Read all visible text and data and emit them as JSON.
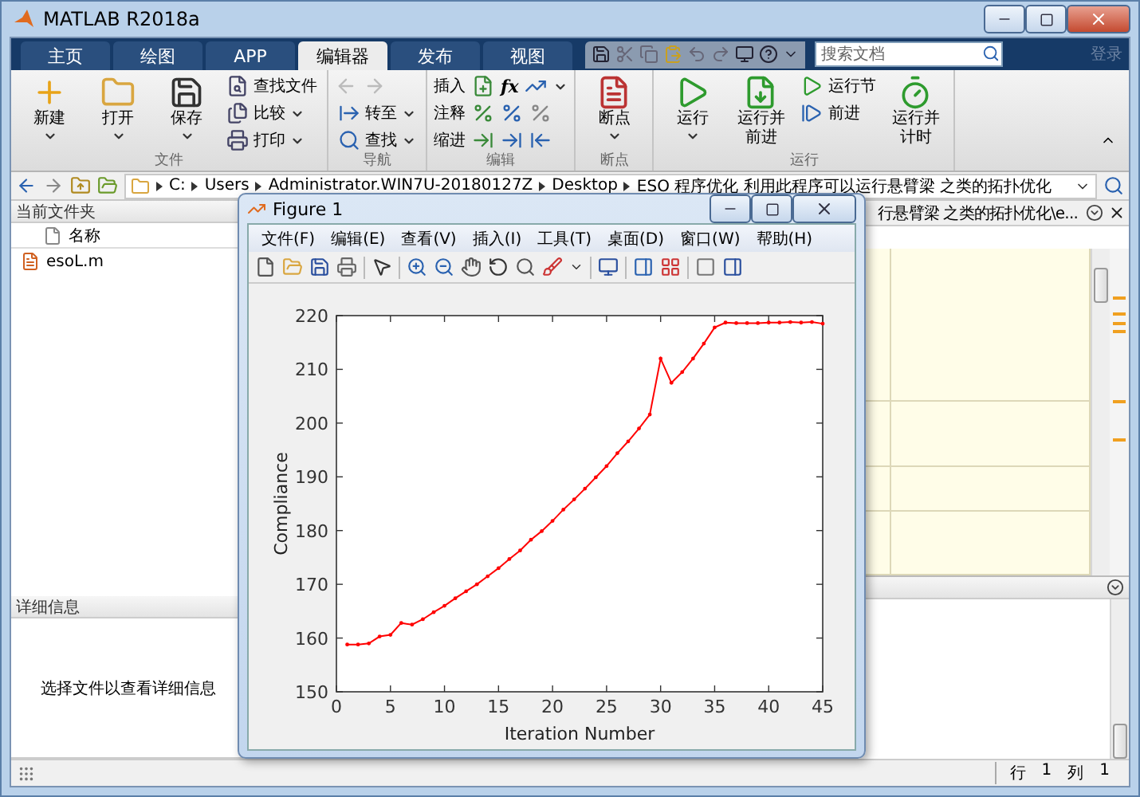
{
  "window": {
    "title": "MATLAB R2018a"
  },
  "tabs": [
    {
      "label": "主页",
      "selected": false
    },
    {
      "label": "绘图",
      "selected": false
    },
    {
      "label": "APP",
      "selected": false
    },
    {
      "label": "编辑器",
      "selected": true
    },
    {
      "label": "发布",
      "selected": false
    },
    {
      "label": "视图",
      "selected": false
    }
  ],
  "search": {
    "placeholder": "搜索文档"
  },
  "login": {
    "label": "登录",
    "disabled": true
  },
  "ribbon": [
    {
      "label": "文件",
      "items": [
        {
          "kind": "large",
          "label": "新建",
          "dropdown": true
        },
        {
          "kind": "large",
          "label": "打开",
          "dropdown": true
        },
        {
          "kind": "large",
          "label": "保存",
          "dropdown": true
        },
        {
          "kind": "stack",
          "rows": [
            {
              "kind": "button",
              "label": "查找文件",
              "dropdown": false
            },
            {
              "kind": "button",
              "label": "比较",
              "dropdown": true
            },
            {
              "kind": "button",
              "label": "打印",
              "dropdown": true
            }
          ]
        }
      ]
    },
    {
      "label": "导航",
      "items": [
        {
          "kind": "stack",
          "rows": [
            {
              "kind": "arrows",
              "disabled": true
            },
            {
              "kind": "button",
              "label": "转至",
              "dropdown": true
            },
            {
              "kind": "button",
              "label": "查找",
              "dropdown": true
            }
          ]
        }
      ]
    },
    {
      "label": "编辑",
      "items": [
        {
          "kind": "stack",
          "rows": [
            {
              "kind": "tools",
              "label": "插入",
              "glyph": "fx",
              "dropdown": true
            },
            {
              "kind": "tools",
              "label": "注释",
              "dropdown": false
            },
            {
              "kind": "tools",
              "label": "缩进",
              "dropdown": false
            }
          ]
        }
      ]
    },
    {
      "label": "断点",
      "items": [
        {
          "kind": "large",
          "label": "断点",
          "dropdown": true
        }
      ]
    },
    {
      "label": "运行",
      "items": [
        {
          "kind": "large",
          "label": "运行",
          "dropdown": true
        },
        {
          "kind": "large",
          "label_lines": [
            "运行并",
            "前进"
          ],
          "dropdown": false
        },
        {
          "kind": "stack",
          "rows": [
            {
              "kind": "button",
              "label": "运行节",
              "dropdown": false
            },
            {
              "kind": "button",
              "label": "前进",
              "dropdown": false
            }
          ]
        },
        {
          "kind": "large",
          "label_lines": [
            "运行并",
            "计时"
          ],
          "dropdown": false
        }
      ]
    }
  ],
  "address": [
    "C:",
    "Users",
    "Administrator.WIN7U-20180127Z",
    "Desktop",
    "ESO 程序优化 利用此程序可以运行悬臂梁 之类的拓扑优化"
  ],
  "current_folder": {
    "title": "当前文件夹",
    "column": "名称",
    "files": [
      {
        "name": "esoL.m"
      }
    ]
  },
  "details": {
    "title": "详细信息",
    "message": "选择文件以查看详细信息"
  },
  "editor": {
    "tab": "行悬臂梁 之类的拓扑优化\\e..."
  },
  "status_bar": {
    "row_label": "行",
    "row": "1",
    "col_label": "列",
    "col": "1"
  },
  "figure": {
    "title": "Figure 1",
    "menu": [
      "文件(F)",
      "编辑(E)",
      "查看(V)",
      "插入(I)",
      "工具(T)",
      "桌面(D)",
      "窗口(W)",
      "帮助(H)"
    ],
    "chart_data": {
      "type": "line",
      "xlabel": "Iteration Number",
      "ylabel": "Compliance",
      "xlim": [
        0,
        45
      ],
      "ylim": [
        150,
        220
      ],
      "xticks": [
        0,
        5,
        10,
        15,
        20,
        25,
        30,
        35,
        40,
        45
      ],
      "yticks": [
        150,
        160,
        170,
        180,
        190,
        200,
        210,
        220
      ],
      "x": [
        1,
        2,
        3,
        4,
        5,
        6,
        7,
        8,
        9,
        10,
        11,
        12,
        13,
        14,
        15,
        16,
        17,
        18,
        19,
        20,
        21,
        22,
        23,
        24,
        25,
        26,
        27,
        28,
        29,
        30,
        31,
        32,
        33,
        34,
        35,
        36,
        37,
        38,
        39,
        40,
        41,
        42,
        43,
        44,
        45
      ],
      "series": [
        {
          "color": "#ff0000",
          "values": [
            158.8,
            158.8,
            159,
            160.3,
            160.6,
            162.8,
            162.5,
            163.5,
            164.8,
            166,
            167.4,
            168.7,
            170,
            171.5,
            173,
            174.7,
            176.3,
            178.3,
            179.9,
            181.8,
            183.9,
            185.8,
            187.8,
            189.9,
            192,
            194.4,
            196.6,
            199,
            201.6,
            212,
            207.5,
            209.5,
            212,
            214.8,
            217.8,
            218.7,
            218.6,
            218.6,
            218.6,
            218.7,
            218.7,
            218.8,
            218.7,
            218.8,
            218.5
          ]
        }
      ]
    }
  }
}
